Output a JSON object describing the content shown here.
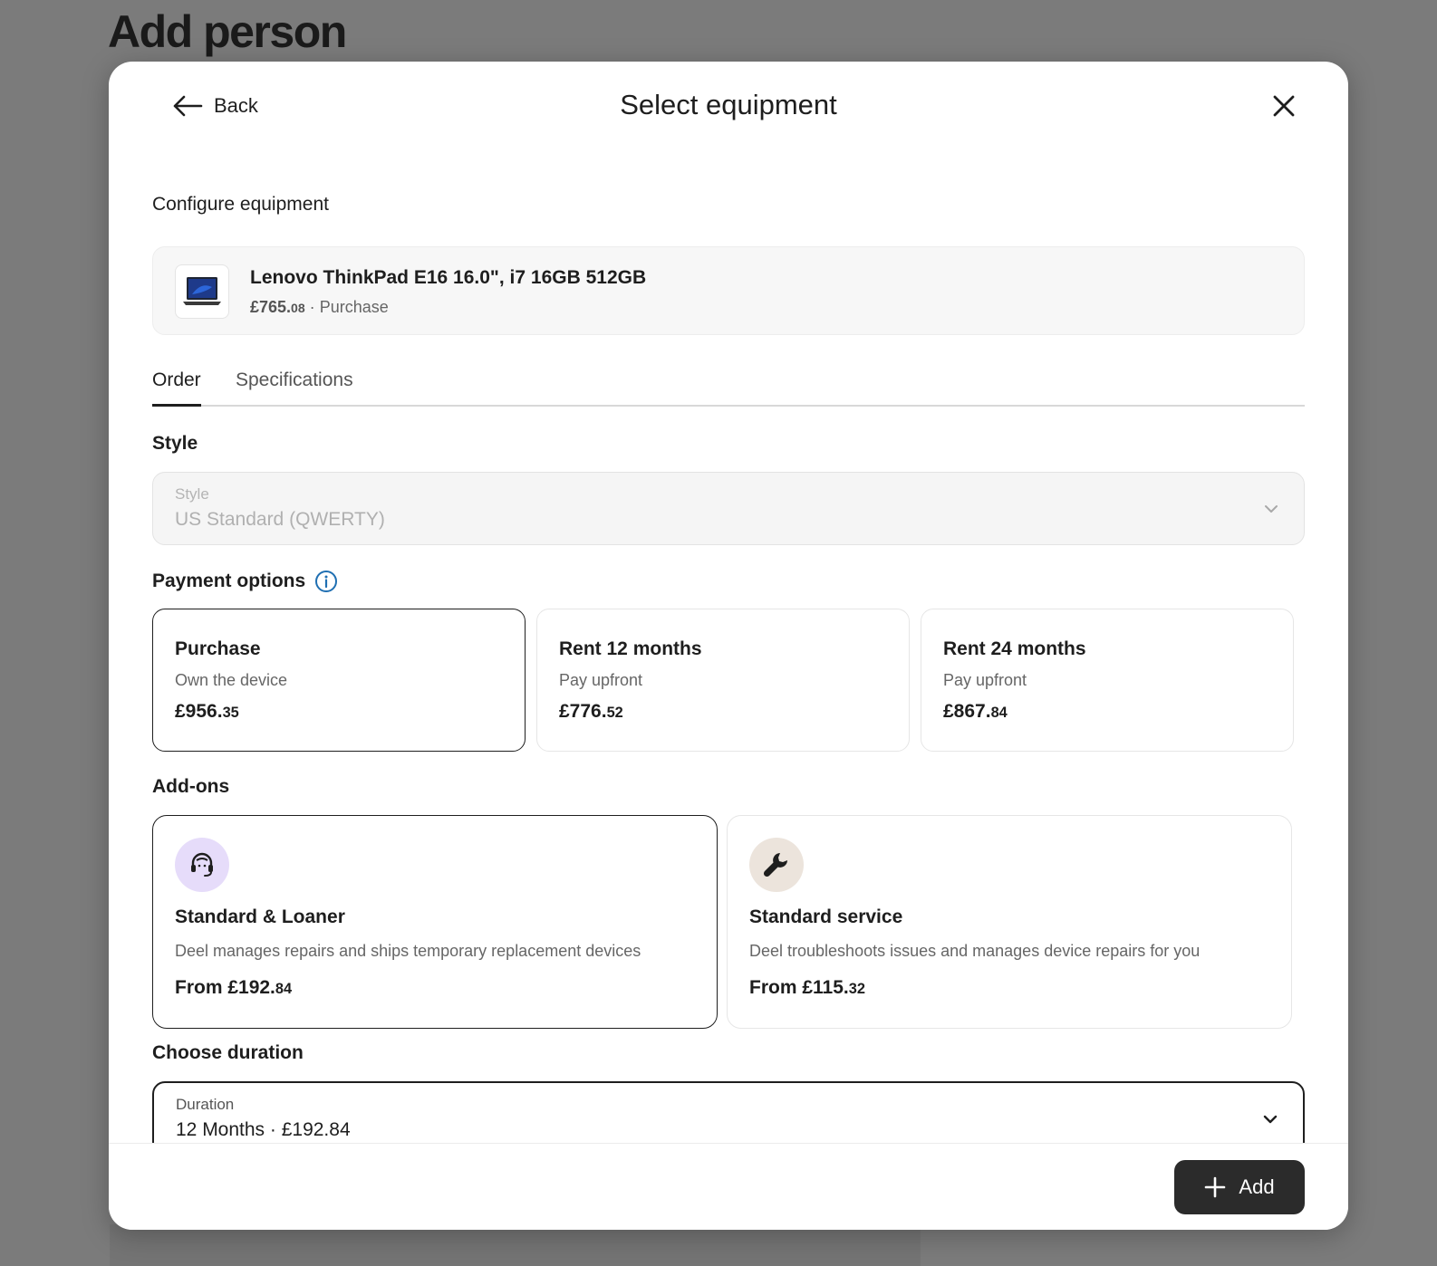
{
  "background": {
    "page_title": "Add person"
  },
  "header": {
    "back_label": "Back",
    "title": "Select equipment"
  },
  "configure": {
    "label": "Configure equipment",
    "product": {
      "name": "Lenovo ThinkPad E16 16.0\", i7 16GB 512GB",
      "price_main": "£765.",
      "price_cents": "08",
      "separator": "·",
      "mode": "Purchase"
    }
  },
  "tabs": [
    {
      "label": "Order",
      "active": true
    },
    {
      "label": "Specifications",
      "active": false
    }
  ],
  "style": {
    "heading": "Style",
    "caption": "Style",
    "value": "US Standard (QWERTY)",
    "disabled": true
  },
  "payment": {
    "heading": "Payment options",
    "options": [
      {
        "title": "Purchase",
        "subtitle": "Own the device",
        "price_main": "£956.",
        "price_cents": "35",
        "selected": true
      },
      {
        "title": "Rent 12 months",
        "subtitle": "Pay upfront",
        "price_main": "£776.",
        "price_cents": "52",
        "selected": false
      },
      {
        "title": "Rent 24 months",
        "subtitle": "Pay upfront",
        "price_main": "£867.",
        "price_cents": "84",
        "selected": false
      }
    ]
  },
  "addons": {
    "heading": "Add-ons",
    "items": [
      {
        "title": "Standard & Loaner",
        "description": "Deel manages repairs and ships temporary replacement devices",
        "price_main": "From £192.",
        "price_cents": "84",
        "icon": "headset-icon",
        "icon_bg": "#e6dcfa",
        "selected": true
      },
      {
        "title": "Standard service",
        "description": "Deel troubleshoots issues and manages device repairs for you",
        "price_main": "From £115.",
        "price_cents": "32",
        "icon": "wrench-icon",
        "icon_bg": "#ece4dc",
        "selected": false
      }
    ]
  },
  "duration": {
    "heading": "Choose duration",
    "caption": "Duration",
    "value": "12 Months · £192.84"
  },
  "footer": {
    "add_label": "Add"
  },
  "colors": {
    "primary_button": "#2b2b2b",
    "info_icon": "#1f6fb2",
    "overlay": "#7b7b7b"
  }
}
